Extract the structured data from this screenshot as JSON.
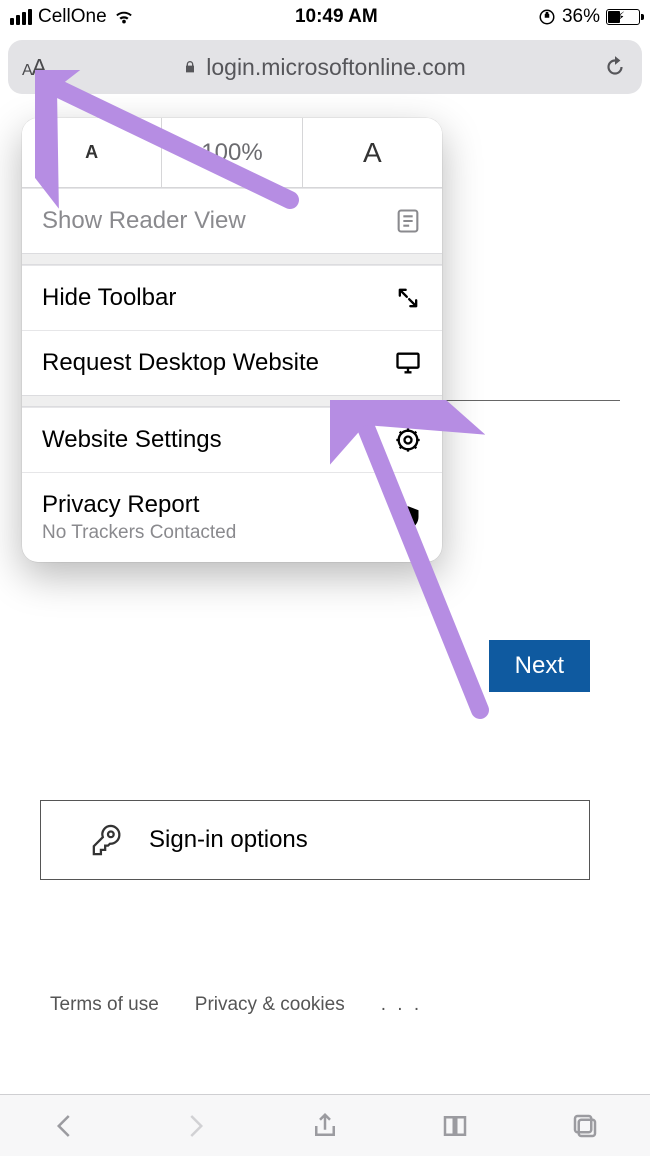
{
  "status": {
    "carrier": "CellOne",
    "time": "10:49 AM",
    "battery_pct": "36%",
    "orientation_lock": "⊘"
  },
  "urlbar": {
    "aa_label": "AA",
    "host": "login.microsoftonline.com"
  },
  "popover": {
    "zoom_small": "A",
    "zoom_value": "100%",
    "zoom_big": "A",
    "reader": "Show Reader View",
    "hide_toolbar": "Hide Toolbar",
    "request_desktop": "Request Desktop Website",
    "website_settings": "Website Settings",
    "privacy_report": "Privacy Report",
    "privacy_sub": "No Trackers Contacted"
  },
  "page": {
    "next": "Next",
    "signin_options": "Sign-in options",
    "terms": "Terms of use",
    "privacy": "Privacy & cookies",
    "more": ". . ."
  },
  "colors": {
    "annotation": "#b68de3",
    "next_btn": "#0f5aa0"
  }
}
